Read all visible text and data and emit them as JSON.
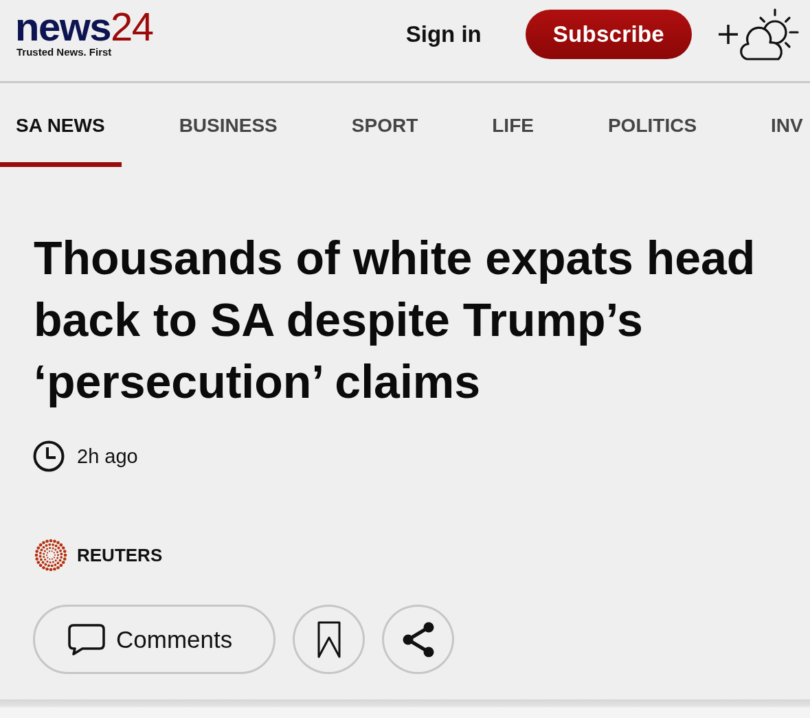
{
  "header": {
    "logo": {
      "word": "news",
      "number": "24",
      "tagline": "Trusted News. First"
    },
    "sign_in": "Sign in",
    "subscribe": "Subscribe"
  },
  "nav": {
    "tabs": [
      {
        "label": "SA NEWS",
        "selected": true
      },
      {
        "label": "BUSINESS",
        "selected": false
      },
      {
        "label": "SPORT",
        "selected": false
      },
      {
        "label": "LIFE",
        "selected": false
      },
      {
        "label": "POLITICS",
        "selected": false
      },
      {
        "label": "INV",
        "selected": false
      }
    ]
  },
  "article": {
    "headline": "Thousands of white expats head back to SA despite Trump’s ‘persecution’ claims",
    "time": "2h ago",
    "source": "REUTERS",
    "actions": [
      {
        "kind": "comments",
        "label": "Comments"
      },
      {
        "kind": "bookmark"
      },
      {
        "kind": "share"
      }
    ]
  }
}
